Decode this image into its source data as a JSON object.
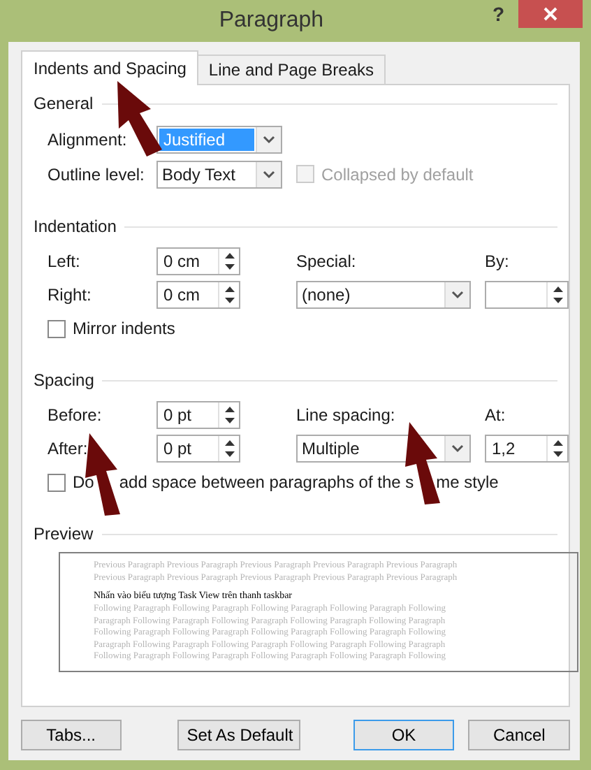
{
  "window": {
    "title": "Paragraph",
    "help": "?"
  },
  "tabs": [
    {
      "label": "Indents and Spacing",
      "selected": true
    },
    {
      "label": "Line and Page Breaks",
      "selected": false
    }
  ],
  "general": {
    "title": "General",
    "alignment": {
      "label": "Alignment:",
      "value": "Justified",
      "highlighted": true
    },
    "outline_level": {
      "label": "Outline level:",
      "value": "Body Text"
    },
    "collapsed": {
      "label": "Collapsed by default",
      "checked": false,
      "disabled": true
    }
  },
  "indentation": {
    "title": "Indentation",
    "left": {
      "label": "Left:",
      "value": "0 cm"
    },
    "right": {
      "label": "Right:",
      "value": "0 cm"
    },
    "special": {
      "label": "Special:",
      "value": "(none)"
    },
    "by": {
      "label": "By:"
    },
    "mirror": {
      "label": "Mirror indents",
      "checked": false
    }
  },
  "spacing": {
    "title": "Spacing",
    "before": {
      "label": "Before:",
      "value": "0 pt"
    },
    "after": {
      "label": "After:",
      "value": "0 pt"
    },
    "line_spacing": {
      "label": "Line spacing:",
      "value": "Multiple"
    },
    "at": {
      "label": "At:",
      "value": "1,2"
    },
    "dont_add": {
      "label_parts": [
        "Do",
        "add space between paragraphs of the s",
        "me style"
      ],
      "checked": false
    }
  },
  "preview": {
    "title": "Preview",
    "previous_lines": [
      "Previous Paragraph Previous Paragraph Previous Paragraph Previous Paragraph Previous Paragraph",
      "Previous Paragraph Previous Paragraph Previous Paragraph Previous Paragraph Previous Paragraph"
    ],
    "sample": "Nhấn vào biểu tượng Task View trên thanh taskbar",
    "following_lines": [
      "Following Paragraph Following Paragraph Following Paragraph Following Paragraph Following",
      "Paragraph Following Paragraph Following Paragraph Following Paragraph Following Paragraph",
      "Following Paragraph Following Paragraph Following Paragraph Following Paragraph Following",
      "Paragraph Following Paragraph Following Paragraph Following Paragraph Following Paragraph",
      "Following Paragraph Following Paragraph Following Paragraph Following Paragraph Following"
    ]
  },
  "buttons": [
    {
      "label": "Tabs...",
      "default": false
    },
    {
      "label": "Set As Default",
      "default": false
    },
    {
      "label": "OK",
      "default": true
    },
    {
      "label": "Cancel",
      "default": false
    }
  ]
}
